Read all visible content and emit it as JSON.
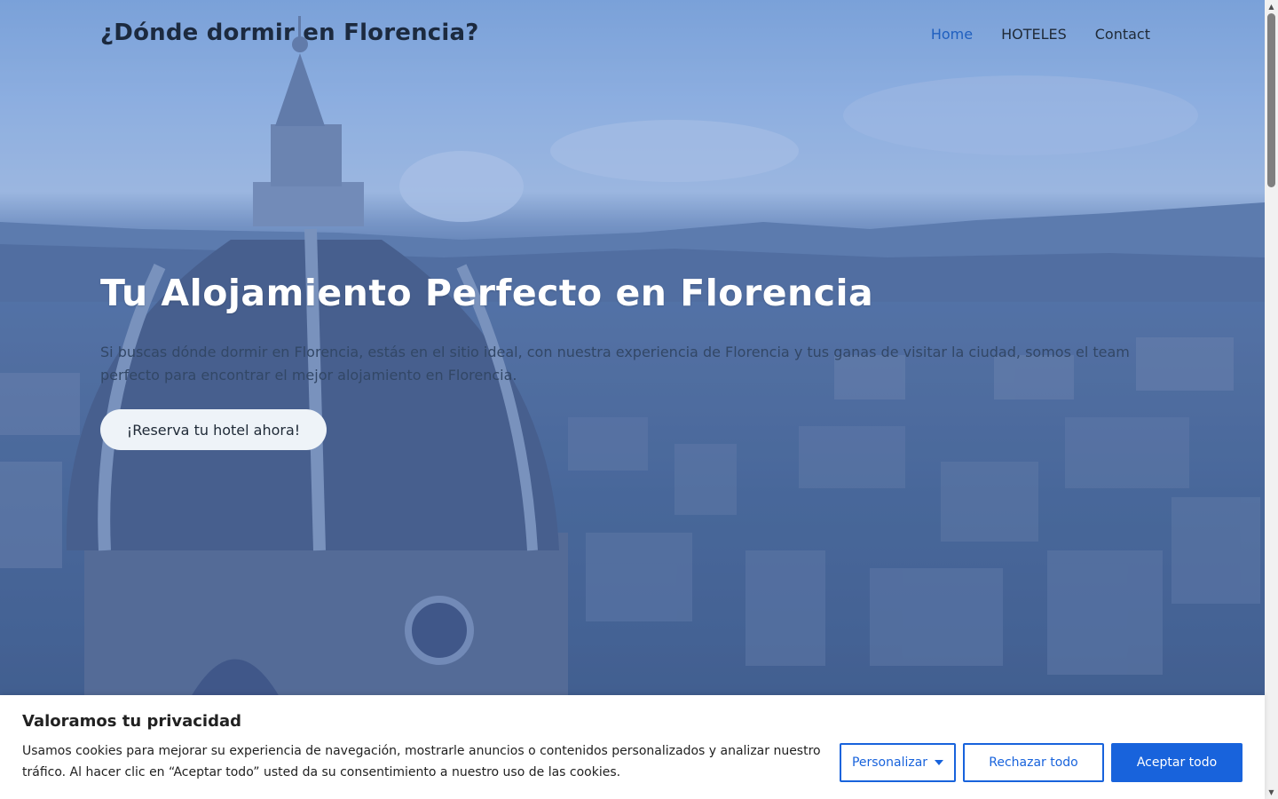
{
  "header": {
    "site_title": "¿Dónde dormir en Florencia?",
    "nav": [
      {
        "label": "Home",
        "active": true
      },
      {
        "label": "HOTELES",
        "active": false
      },
      {
        "label": "Contact",
        "active": false
      }
    ]
  },
  "hero": {
    "heading": "Tu Alojamiento Perfecto en Florencia",
    "text": "Si buscas dónde dormir en Florencia, estás en el sitio ideal, con nuestra experiencia de Florencia y tus ganas de visitar la ciudad, somos el team perfecto para encontrar el mejor alojamiento en Florencia.",
    "cta_label": "¡Reserva tu hotel ahora!"
  },
  "cookie_banner": {
    "title": "Valoramos tu privacidad",
    "text": "Usamos cookies para mejorar su experiencia de navegación, mostrarle anuncios o contenidos personalizados y analizar nuestro tráfico. Al hacer clic en “Aceptar todo” usted da su consentimiento a nuestro uso de las cookies.",
    "customize_label": "Personalizar",
    "reject_label": "Rechazar todo",
    "accept_label": "Aceptar todo"
  },
  "colors": {
    "accent": "#1863dc",
    "nav_active": "#1f5fbf",
    "title": "#1c2a3f"
  },
  "icons": {
    "customize": "caret-down-icon",
    "scroll_up": "scroll-up-arrow-icon",
    "scroll_down": "scroll-down-arrow-icon"
  }
}
